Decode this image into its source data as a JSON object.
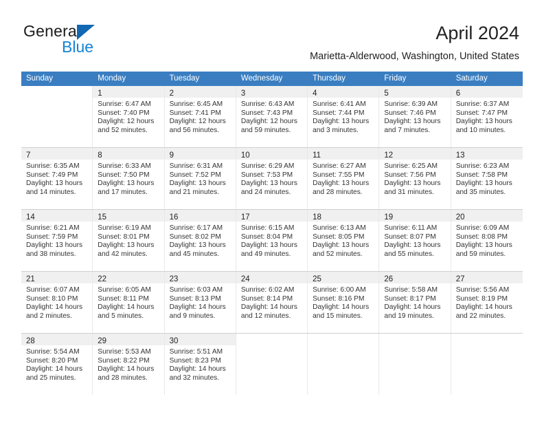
{
  "brand": {
    "name_top": "General",
    "name_bottom": "Blue",
    "triangle_color": "#1268b3",
    "blue_color": "#1383d6"
  },
  "header": {
    "title": "April 2024",
    "subtitle": "Marietta-Alderwood, Washington, United States"
  },
  "theme": {
    "header_row_bg": "#3a7ec1",
    "daynum_bg": "#f0f0f0",
    "grid_line": "#cfcfcf"
  },
  "weekdays": [
    "Sunday",
    "Monday",
    "Tuesday",
    "Wednesday",
    "Thursday",
    "Friday",
    "Saturday"
  ],
  "weeks": [
    [
      {
        "empty": true
      },
      {
        "day": "1",
        "sunrise": "Sunrise: 6:47 AM",
        "sunset": "Sunset: 7:40 PM",
        "daylight_line1": "Daylight: 12 hours",
        "daylight_line2": "and 52 minutes."
      },
      {
        "day": "2",
        "sunrise": "Sunrise: 6:45 AM",
        "sunset": "Sunset: 7:41 PM",
        "daylight_line1": "Daylight: 12 hours",
        "daylight_line2": "and 56 minutes."
      },
      {
        "day": "3",
        "sunrise": "Sunrise: 6:43 AM",
        "sunset": "Sunset: 7:43 PM",
        "daylight_line1": "Daylight: 12 hours",
        "daylight_line2": "and 59 minutes."
      },
      {
        "day": "4",
        "sunrise": "Sunrise: 6:41 AM",
        "sunset": "Sunset: 7:44 PM",
        "daylight_line1": "Daylight: 13 hours",
        "daylight_line2": "and 3 minutes."
      },
      {
        "day": "5",
        "sunrise": "Sunrise: 6:39 AM",
        "sunset": "Sunset: 7:46 PM",
        "daylight_line1": "Daylight: 13 hours",
        "daylight_line2": "and 7 minutes."
      },
      {
        "day": "6",
        "sunrise": "Sunrise: 6:37 AM",
        "sunset": "Sunset: 7:47 PM",
        "daylight_line1": "Daylight: 13 hours",
        "daylight_line2": "and 10 minutes."
      }
    ],
    [
      {
        "day": "7",
        "sunrise": "Sunrise: 6:35 AM",
        "sunset": "Sunset: 7:49 PM",
        "daylight_line1": "Daylight: 13 hours",
        "daylight_line2": "and 14 minutes."
      },
      {
        "day": "8",
        "sunrise": "Sunrise: 6:33 AM",
        "sunset": "Sunset: 7:50 PM",
        "daylight_line1": "Daylight: 13 hours",
        "daylight_line2": "and 17 minutes."
      },
      {
        "day": "9",
        "sunrise": "Sunrise: 6:31 AM",
        "sunset": "Sunset: 7:52 PM",
        "daylight_line1": "Daylight: 13 hours",
        "daylight_line2": "and 21 minutes."
      },
      {
        "day": "10",
        "sunrise": "Sunrise: 6:29 AM",
        "sunset": "Sunset: 7:53 PM",
        "daylight_line1": "Daylight: 13 hours",
        "daylight_line2": "and 24 minutes."
      },
      {
        "day": "11",
        "sunrise": "Sunrise: 6:27 AM",
        "sunset": "Sunset: 7:55 PM",
        "daylight_line1": "Daylight: 13 hours",
        "daylight_line2": "and 28 minutes."
      },
      {
        "day": "12",
        "sunrise": "Sunrise: 6:25 AM",
        "sunset": "Sunset: 7:56 PM",
        "daylight_line1": "Daylight: 13 hours",
        "daylight_line2": "and 31 minutes."
      },
      {
        "day": "13",
        "sunrise": "Sunrise: 6:23 AM",
        "sunset": "Sunset: 7:58 PM",
        "daylight_line1": "Daylight: 13 hours",
        "daylight_line2": "and 35 minutes."
      }
    ],
    [
      {
        "day": "14",
        "sunrise": "Sunrise: 6:21 AM",
        "sunset": "Sunset: 7:59 PM",
        "daylight_line1": "Daylight: 13 hours",
        "daylight_line2": "and 38 minutes."
      },
      {
        "day": "15",
        "sunrise": "Sunrise: 6:19 AM",
        "sunset": "Sunset: 8:01 PM",
        "daylight_line1": "Daylight: 13 hours",
        "daylight_line2": "and 42 minutes."
      },
      {
        "day": "16",
        "sunrise": "Sunrise: 6:17 AM",
        "sunset": "Sunset: 8:02 PM",
        "daylight_line1": "Daylight: 13 hours",
        "daylight_line2": "and 45 minutes."
      },
      {
        "day": "17",
        "sunrise": "Sunrise: 6:15 AM",
        "sunset": "Sunset: 8:04 PM",
        "daylight_line1": "Daylight: 13 hours",
        "daylight_line2": "and 49 minutes."
      },
      {
        "day": "18",
        "sunrise": "Sunrise: 6:13 AM",
        "sunset": "Sunset: 8:05 PM",
        "daylight_line1": "Daylight: 13 hours",
        "daylight_line2": "and 52 minutes."
      },
      {
        "day": "19",
        "sunrise": "Sunrise: 6:11 AM",
        "sunset": "Sunset: 8:07 PM",
        "daylight_line1": "Daylight: 13 hours",
        "daylight_line2": "and 55 minutes."
      },
      {
        "day": "20",
        "sunrise": "Sunrise: 6:09 AM",
        "sunset": "Sunset: 8:08 PM",
        "daylight_line1": "Daylight: 13 hours",
        "daylight_line2": "and 59 minutes."
      }
    ],
    [
      {
        "day": "21",
        "sunrise": "Sunrise: 6:07 AM",
        "sunset": "Sunset: 8:10 PM",
        "daylight_line1": "Daylight: 14 hours",
        "daylight_line2": "and 2 minutes."
      },
      {
        "day": "22",
        "sunrise": "Sunrise: 6:05 AM",
        "sunset": "Sunset: 8:11 PM",
        "daylight_line1": "Daylight: 14 hours",
        "daylight_line2": "and 5 minutes."
      },
      {
        "day": "23",
        "sunrise": "Sunrise: 6:03 AM",
        "sunset": "Sunset: 8:13 PM",
        "daylight_line1": "Daylight: 14 hours",
        "daylight_line2": "and 9 minutes."
      },
      {
        "day": "24",
        "sunrise": "Sunrise: 6:02 AM",
        "sunset": "Sunset: 8:14 PM",
        "daylight_line1": "Daylight: 14 hours",
        "daylight_line2": "and 12 minutes."
      },
      {
        "day": "25",
        "sunrise": "Sunrise: 6:00 AM",
        "sunset": "Sunset: 8:16 PM",
        "daylight_line1": "Daylight: 14 hours",
        "daylight_line2": "and 15 minutes."
      },
      {
        "day": "26",
        "sunrise": "Sunrise: 5:58 AM",
        "sunset": "Sunset: 8:17 PM",
        "daylight_line1": "Daylight: 14 hours",
        "daylight_line2": "and 19 minutes."
      },
      {
        "day": "27",
        "sunrise": "Sunrise: 5:56 AM",
        "sunset": "Sunset: 8:19 PM",
        "daylight_line1": "Daylight: 14 hours",
        "daylight_line2": "and 22 minutes."
      }
    ],
    [
      {
        "day": "28",
        "sunrise": "Sunrise: 5:54 AM",
        "sunset": "Sunset: 8:20 PM",
        "daylight_line1": "Daylight: 14 hours",
        "daylight_line2": "and 25 minutes."
      },
      {
        "day": "29",
        "sunrise": "Sunrise: 5:53 AM",
        "sunset": "Sunset: 8:22 PM",
        "daylight_line1": "Daylight: 14 hours",
        "daylight_line2": "and 28 minutes."
      },
      {
        "day": "30",
        "sunrise": "Sunrise: 5:51 AM",
        "sunset": "Sunset: 8:23 PM",
        "daylight_line1": "Daylight: 14 hours",
        "daylight_line2": "and 32 minutes."
      },
      {
        "empty": true
      },
      {
        "empty": true
      },
      {
        "empty": true
      },
      {
        "empty": true
      }
    ]
  ]
}
